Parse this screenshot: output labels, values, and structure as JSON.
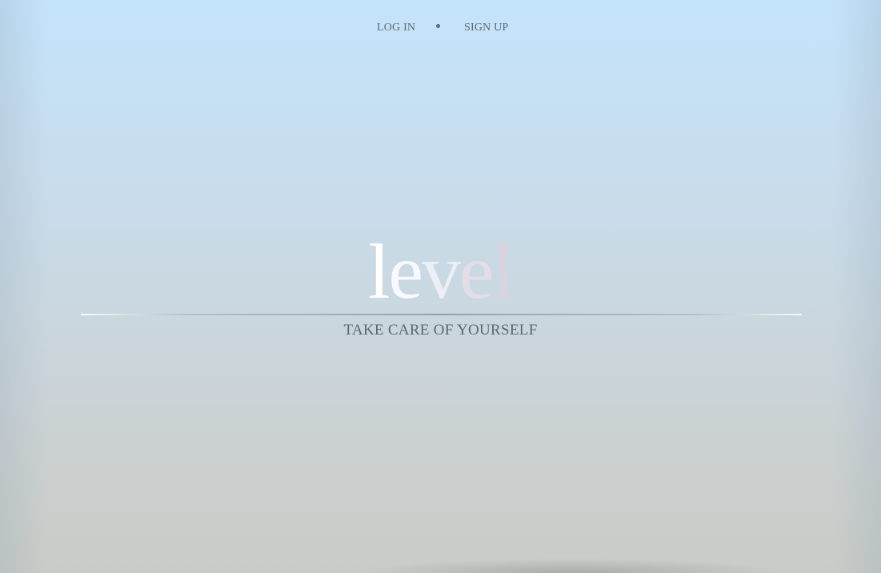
{
  "nav": {
    "login_label": "LOG IN",
    "separator": "•",
    "signup_label": "SIGN UP"
  },
  "logo": {
    "letters": [
      "l",
      "e",
      "v",
      "e",
      "l"
    ]
  },
  "tagline": "TAKE CARE OF YOURSELF",
  "colors": {
    "background_top": "#c3e3fb",
    "background_bottom": "#c9cbc6",
    "nav_text": "#5d6a78",
    "tagline_text": "#5e6670",
    "logo_start": "#ffffff",
    "logo_end": "#dcd3e0"
  }
}
